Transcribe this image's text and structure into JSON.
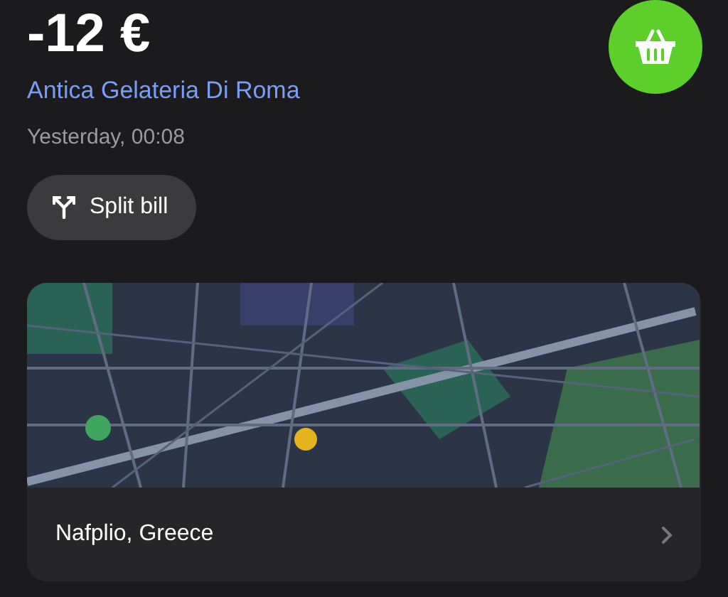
{
  "amount": "-12 €",
  "merchant": "Antica Gelateria Di Roma",
  "time": "Yesterday, 00:08",
  "split_button": {
    "label": "Split bill"
  },
  "location_card": {
    "place": "Nafplio, Greece"
  }
}
